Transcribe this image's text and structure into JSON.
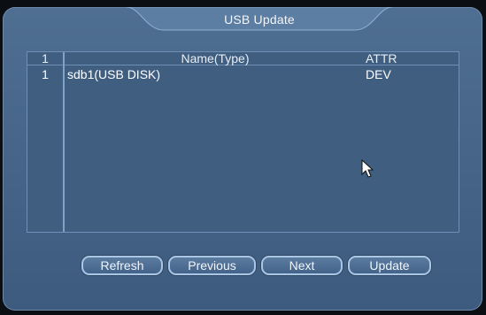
{
  "dialog": {
    "title": "USB Update"
  },
  "table": {
    "headers": {
      "index": "1",
      "name": "Name(Type)",
      "attr": "ATTR"
    },
    "rows": [
      {
        "index": "1",
        "name": "sdb1(USB DISK)",
        "attr": "DEV"
      }
    ]
  },
  "buttons": {
    "refresh": "Refresh",
    "previous": "Previous",
    "next": "Next",
    "update": "Update"
  },
  "colors": {
    "dialog_bg": "#4a6a8e",
    "panel_border": "#6e90b6",
    "button_border": "#a9c6e4"
  },
  "icons": {
    "cursor": "mouse-pointer-icon"
  }
}
